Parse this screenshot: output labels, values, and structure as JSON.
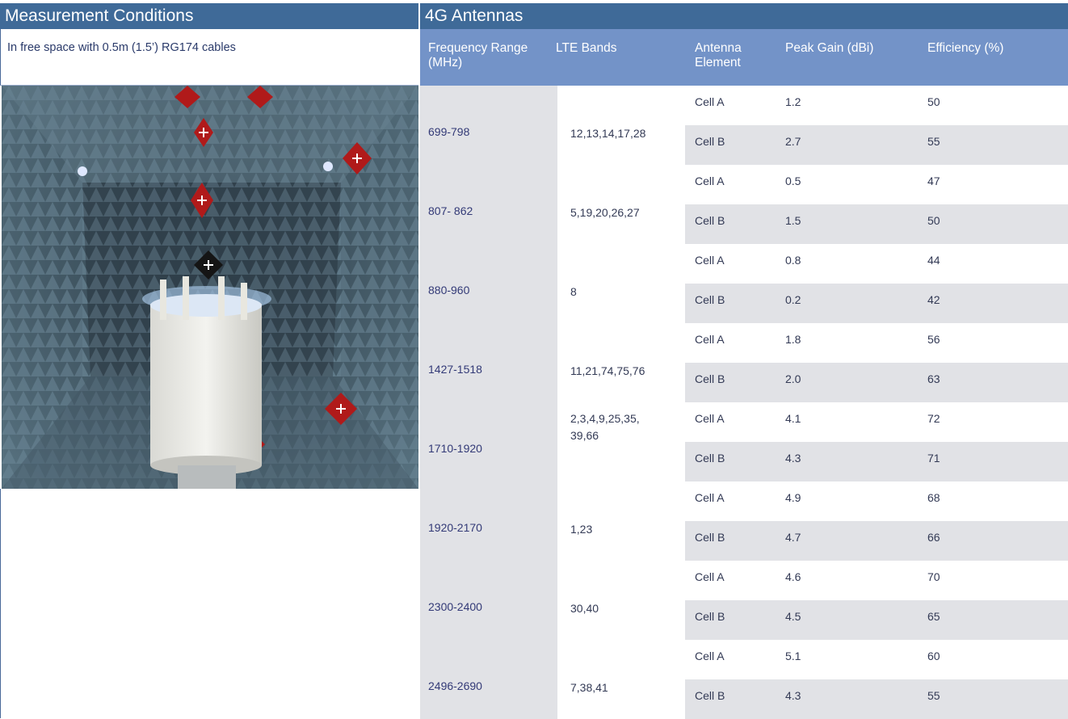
{
  "left": {
    "title": "Measurement Conditions",
    "description": "In free space with 0.5m (1.5’) RG174 cables"
  },
  "right": {
    "title": "4G Antennas",
    "headers": {
      "freq": "Frequency Range (MHz)",
      "bands": "LTE Bands",
      "element": "Antenna Element",
      "gain": "Peak Gain (dBi)",
      "eff": "Efficiency (%)"
    },
    "rows": [
      {
        "freq": "699-798",
        "bands": "12,13,14,17,28",
        "a": {
          "el": "Cell A",
          "gain": "1.2",
          "eff": "50"
        },
        "b": {
          "el": "Cell B",
          "gain": "2.7",
          "eff": "55"
        }
      },
      {
        "freq": "807- 862",
        "bands": "5,19,20,26,27",
        "a": {
          "el": "Cell A",
          "gain": "0.5",
          "eff": "47"
        },
        "b": {
          "el": "Cell B",
          "gain": "1.5",
          "eff": "50"
        }
      },
      {
        "freq": "880-960",
        "bands": "8",
        "a": {
          "el": "Cell A",
          "gain": "0.8",
          "eff": "44"
        },
        "b": {
          "el": "Cell B",
          "gain": "0.2",
          "eff": "42"
        }
      },
      {
        "freq": "1427-1518",
        "bands": "11,21,74,75,76",
        "a": {
          "el": "Cell A",
          "gain": "1.8",
          "eff": "56"
        },
        "b": {
          "el": "Cell B",
          "gain": "2.0",
          "eff": "63"
        }
      },
      {
        "freq": "1710-1920",
        "bands": "2,3,4,9,25,35,\n39,66",
        "a": {
          "el": "Cell A",
          "gain": "4.1",
          "eff": "72"
        },
        "b": {
          "el": "Cell B",
          "gain": "4.3",
          "eff": "71"
        }
      },
      {
        "freq": "1920-2170",
        "bands": "1,23",
        "a": {
          "el": "Cell A",
          "gain": "4.9",
          "eff": "68"
        },
        "b": {
          "el": "Cell B",
          "gain": "4.7",
          "eff": "66"
        }
      },
      {
        "freq": "2300-2400",
        "bands": "30,40",
        "a": {
          "el": "Cell A",
          "gain": "4.6",
          "eff": "70"
        },
        "b": {
          "el": "Cell B",
          "gain": "4.5",
          "eff": "65"
        }
      },
      {
        "freq": "2496-2690",
        "bands": "7,38,41",
        "a": {
          "el": "Cell A",
          "gain": "5.1",
          "eff": "60"
        },
        "b": {
          "el": "Cell B",
          "gain": "4.3",
          "eff": "55"
        }
      }
    ]
  }
}
